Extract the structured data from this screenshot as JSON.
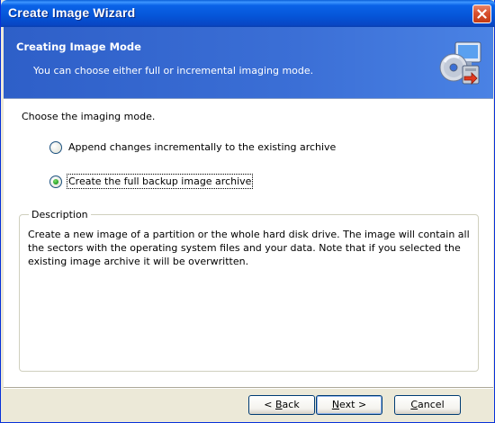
{
  "window": {
    "title": "Create Image Wizard",
    "close_label": "✕"
  },
  "header": {
    "title": "Creating Image Mode",
    "subtitle": "You can choose either full or incremental imaging mode.",
    "icon": "disk-image-wizard-icon"
  },
  "main": {
    "prompt": "Choose the imaging mode.",
    "options": [
      {
        "label": "Append changes incrementally to the existing archive",
        "selected": false
      },
      {
        "label": "Create the full backup image archive",
        "selected": true
      }
    ],
    "description": {
      "caption": "Description",
      "text": "Create a new image of a partition or the whole hard disk drive. The image will contain all the sectors with the operating system files and your data. Note that if you selected the existing image archive it will be overwritten."
    }
  },
  "footer": {
    "back_prefix": "< ",
    "back_accel": "B",
    "back_rest": "ack",
    "next_accel": "N",
    "next_rest": "ext >",
    "cancel_accel": "C",
    "cancel_rest": "ancel"
  },
  "colors": {
    "titlebar": "#0555d8",
    "header": "#3b6fd6",
    "radio_selected": "#2aa52a",
    "close_button": "#d8502e"
  }
}
